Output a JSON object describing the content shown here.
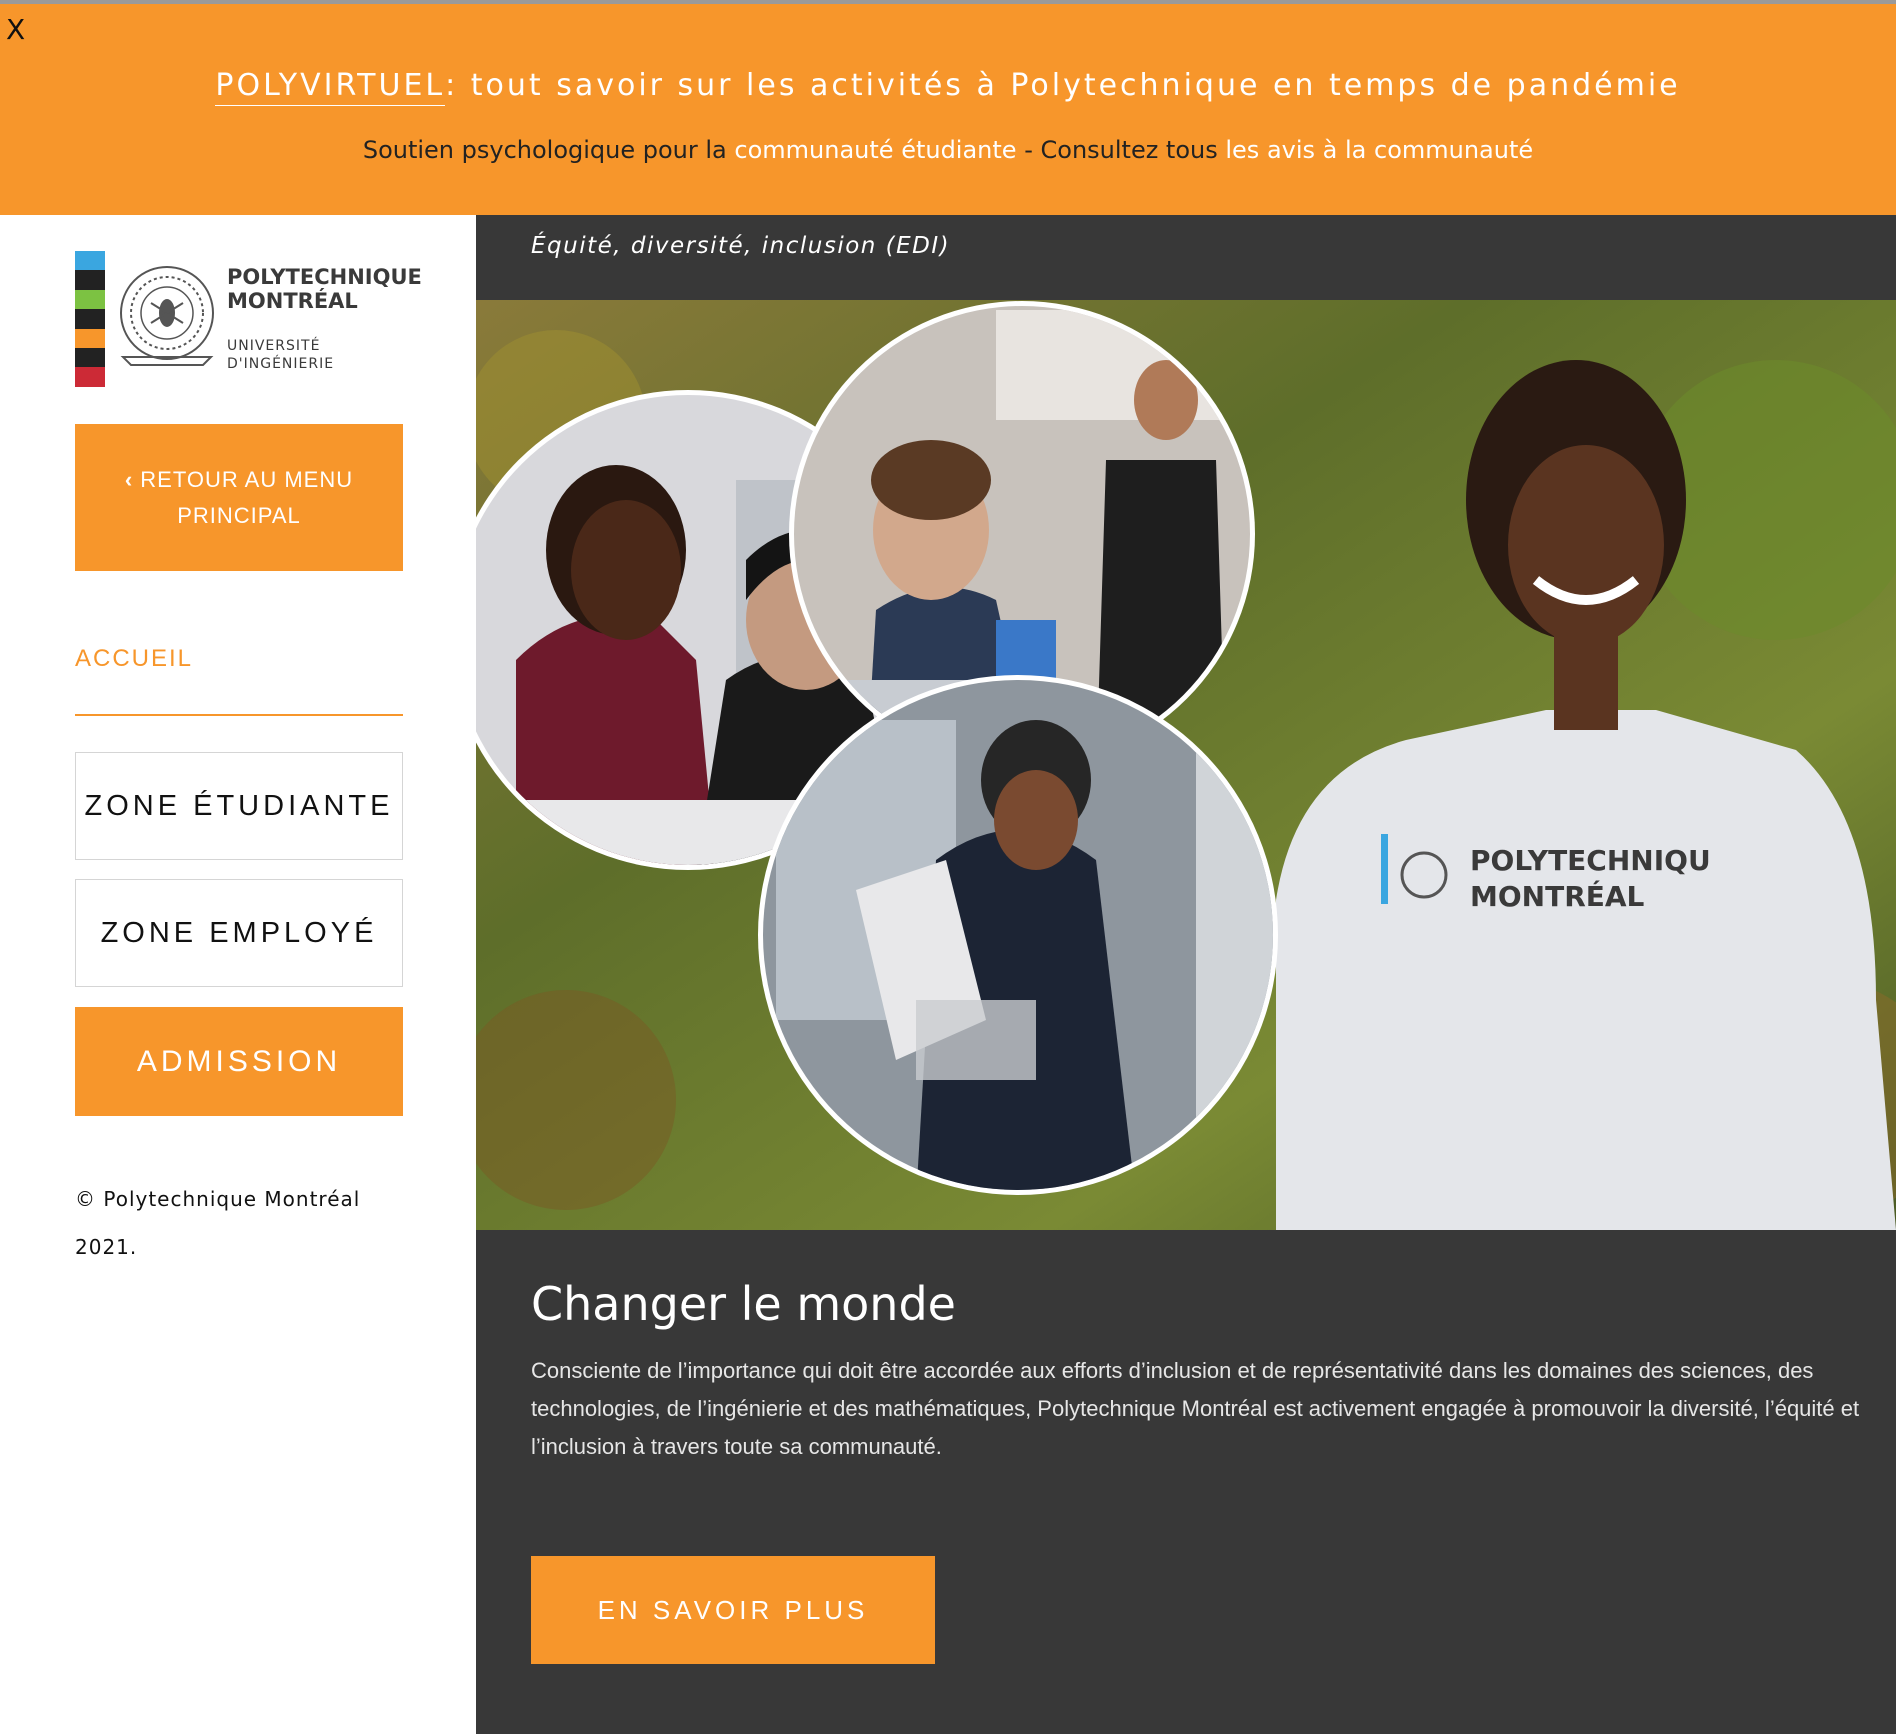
{
  "banner": {
    "close_label": "X",
    "title_prefix": "POLYVIRTUEL",
    "title_rest": ": tout savoir sur les activités à Polytechnique en temps de pandémie",
    "sub_text1": "Soutien psychologique pour la ",
    "sub_link1": "communauté étudiante",
    "sub_text2": " - Consultez tous ",
    "sub_link2": "les avis à la communauté",
    "bg_color": "#f7962b"
  },
  "logo": {
    "line1": "POLYTECHNIQUE",
    "line2": "MONTRÉAL",
    "line3": "UNIVERSITÉ",
    "line4": "D'INGÉNIERIE"
  },
  "sidebar": {
    "back_icon": "chevron-left-icon",
    "back_label": "RETOUR AU MENU PRINCIPAL",
    "home_label": "ACCUEIL",
    "zone_student": "ZONE ÉTUDIANTE",
    "zone_employee": "ZONE EMPLOYÉ",
    "admission": "ADMISSION",
    "copyright": "© Polytechnique Montréal 2021."
  },
  "main": {
    "breadcrumb": "Équité, diversité, inclusion (EDI)",
    "hero_hoodie_text1": "POLYTECHNIQU",
    "hero_hoodie_text2": "MONTRÉAL",
    "title": "Changer le monde",
    "body": "Consciente de l’importance qui doit être accordée aux efforts d’inclusion et de représentativité dans les domaines des sciences, des technologies, de l’ingénierie et des mathématiques, Polytechnique Montréal est activement engagée à promouvoir la diversité, l’équité et l’inclusion à travers toute sa communauté.",
    "cta": "EN SAVOIR PLUS"
  },
  "colors": {
    "accent": "#f7962b",
    "dark_panel": "#383838",
    "logo_bars": [
      "#3aa6e0",
      "#222222",
      "#7cc242",
      "#222222",
      "#f7962b",
      "#222222",
      "#cc2a36"
    ]
  }
}
